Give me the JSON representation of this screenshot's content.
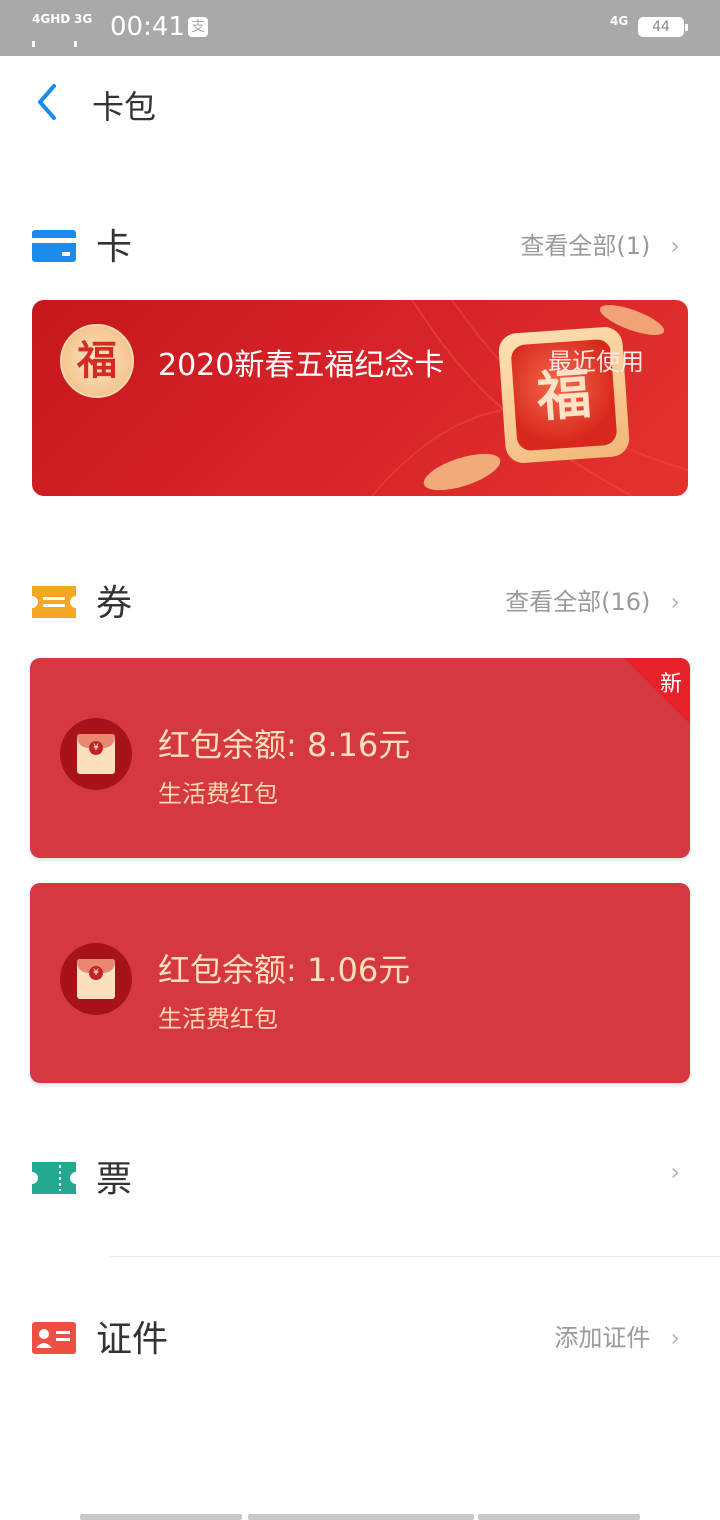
{
  "status_bar": {
    "sim1": "4GHD",
    "sim2": "3G",
    "time": "00:41",
    "app_badge": "支",
    "network_right": "4G",
    "battery": "44"
  },
  "header": {
    "title": "卡包"
  },
  "cards_section": {
    "title": "卡",
    "link": "查看全部(1)",
    "card": {
      "logo_char": "福",
      "title": "2020新春五福纪念卡",
      "tag": "最近使用",
      "art_char": "福"
    }
  },
  "coupons_section": {
    "title": "券",
    "link": "查看全部(16)",
    "items": [
      {
        "amount": "红包余额: 8.16元",
        "subtitle": "生活费红包",
        "badge": "新"
      },
      {
        "amount": "红包余额: 1.06元",
        "subtitle": "生活费红包"
      }
    ]
  },
  "tickets_section": {
    "title": "票"
  },
  "ids_section": {
    "title": "证件",
    "link": "添加证件"
  },
  "colors": {
    "accent_blue": "#1a8cf0",
    "coupon_red": "#d63841",
    "card_red": "#d62228",
    "ticket_green": "#24a98e",
    "coupon_orange": "#f5a623"
  }
}
